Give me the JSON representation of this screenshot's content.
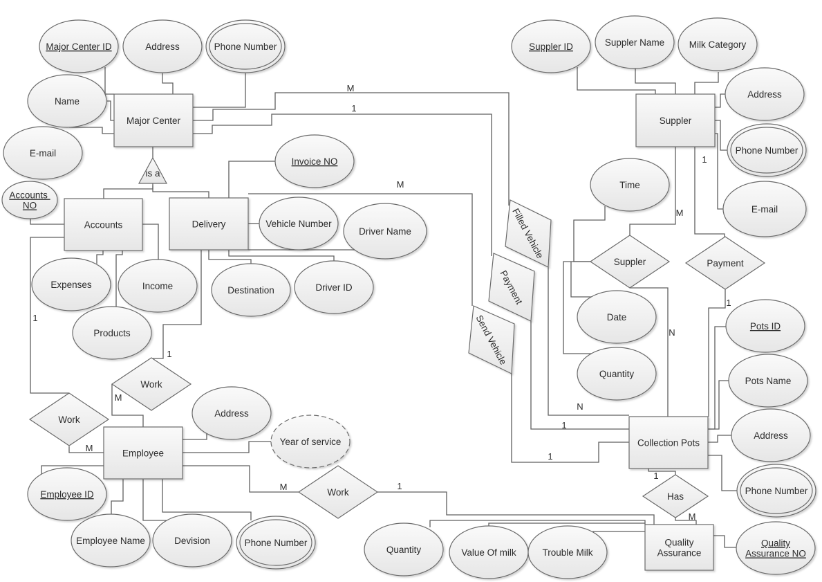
{
  "diagram": {
    "type": "Entity-Relationship Diagram",
    "entities": [
      {
        "id": "major_center",
        "label": "Major Center"
      },
      {
        "id": "accounts",
        "label": "Accounts"
      },
      {
        "id": "delivery",
        "label": "Delivery"
      },
      {
        "id": "employee",
        "label": "Employee"
      },
      {
        "id": "suppler",
        "label": "Suppler"
      },
      {
        "id": "collection_pots",
        "label": "Collection Pots"
      },
      {
        "id": "quality_assurance",
        "label": "Quality Assurance",
        "lines": [
          "Quality",
          "Assurance"
        ]
      }
    ],
    "isa": {
      "label": "is a"
    },
    "relationships": [
      {
        "id": "rel_work_accounts",
        "label": "Work"
      },
      {
        "id": "rel_work_delivery",
        "label": "Work"
      },
      {
        "id": "rel_work_qa",
        "label": "Work"
      },
      {
        "id": "rel_suppler",
        "label": "Suppler"
      },
      {
        "id": "rel_payment",
        "label": "Payment"
      },
      {
        "id": "rel_has",
        "label": "Has"
      },
      {
        "id": "rel_filled_vehicle",
        "label": "Filled Vehicle"
      },
      {
        "id": "rel_payment_skew",
        "label": "Payment"
      },
      {
        "id": "rel_send_vehicle",
        "label": "Send Vehicle"
      }
    ],
    "attributes": [
      {
        "id": "mc_id",
        "label": "Major Center ID",
        "key": true
      },
      {
        "id": "mc_address",
        "label": "Address"
      },
      {
        "id": "mc_phone",
        "label": "Phone Number",
        "multivalued": true
      },
      {
        "id": "mc_name",
        "label": "Name"
      },
      {
        "id": "mc_email",
        "label": "E-mail"
      },
      {
        "id": "acc_no",
        "label": "Accounts NO",
        "lines": [
          "Accounts ",
          "NO"
        ],
        "key": true
      },
      {
        "id": "acc_expenses",
        "label": "Expenses"
      },
      {
        "id": "acc_income",
        "label": "Income"
      },
      {
        "id": "acc_products",
        "label": "Products"
      },
      {
        "id": "del_invoice",
        "label": "Invoice NO",
        "key": true
      },
      {
        "id": "del_vehicle",
        "label": "Vehicle Number"
      },
      {
        "id": "del_driver_name",
        "label": "Driver Name"
      },
      {
        "id": "del_destination",
        "label": "Destination"
      },
      {
        "id": "del_driver_id",
        "label": "Driver ID"
      },
      {
        "id": "emp_address",
        "label": "Address"
      },
      {
        "id": "emp_years",
        "label": "Year of service",
        "derived": true
      },
      {
        "id": "emp_id",
        "label": "Employee ID",
        "key": true
      },
      {
        "id": "emp_name",
        "label": "Employee Name"
      },
      {
        "id": "emp_division",
        "label": "Devision"
      },
      {
        "id": "emp_phone",
        "label": "Phone Number",
        "multivalued": true
      },
      {
        "id": "sup_id",
        "label": "Suppler ID",
        "key": true
      },
      {
        "id": "sup_name",
        "label": "Suppler Name"
      },
      {
        "id": "sup_milk",
        "label": "Milk Category"
      },
      {
        "id": "sup_address",
        "label": "Address"
      },
      {
        "id": "sup_phone",
        "label": "Phone Number",
        "multivalued": true
      },
      {
        "id": "sup_email",
        "label": "E-mail"
      },
      {
        "id": "rs_time",
        "label": "Time"
      },
      {
        "id": "rs_date",
        "label": "Date"
      },
      {
        "id": "rs_quantity",
        "label": "Quantity"
      },
      {
        "id": "cp_id",
        "label": "Pots ID",
        "key": true
      },
      {
        "id": "cp_name",
        "label": "Pots Name"
      },
      {
        "id": "cp_address",
        "label": "Address"
      },
      {
        "id": "cp_phone",
        "label": "Phone Number",
        "multivalued": true
      },
      {
        "id": "qa_no",
        "label": "Quality Assurance NO",
        "lines": [
          "Quality",
          "Assurance NO"
        ],
        "key": true
      },
      {
        "id": "qa_quantity",
        "label": "Quantity"
      },
      {
        "id": "qa_value",
        "label": "Value Of milk"
      },
      {
        "id": "qa_trouble",
        "label": "Trouble Milk"
      }
    ],
    "cardinalities": [
      {
        "id": "c_mc_filled",
        "label": "M"
      },
      {
        "id": "c_mc_payment",
        "label": "1"
      },
      {
        "id": "c_del_send",
        "label": "M"
      },
      {
        "id": "c_acc_work",
        "label": "1"
      },
      {
        "id": "c_del_work",
        "label": "1"
      },
      {
        "id": "c_work_emp_m",
        "label": "M"
      },
      {
        "id": "c_emp_work_m",
        "label": "M"
      },
      {
        "id": "c_emp_workqa_m",
        "label": "M"
      },
      {
        "id": "c_workqa_1",
        "label": "1"
      },
      {
        "id": "c_sup_1",
        "label": "1"
      },
      {
        "id": "c_sup_m",
        "label": "M"
      },
      {
        "id": "c_rel_sup_n",
        "label": "N"
      },
      {
        "id": "c_pay_1",
        "label": "1"
      },
      {
        "id": "c_cp_n",
        "label": "N"
      },
      {
        "id": "c_cp_1a",
        "label": "1"
      },
      {
        "id": "c_cp_1b",
        "label": "1"
      },
      {
        "id": "c_has_1",
        "label": "1"
      },
      {
        "id": "c_has_m",
        "label": "M"
      }
    ]
  }
}
